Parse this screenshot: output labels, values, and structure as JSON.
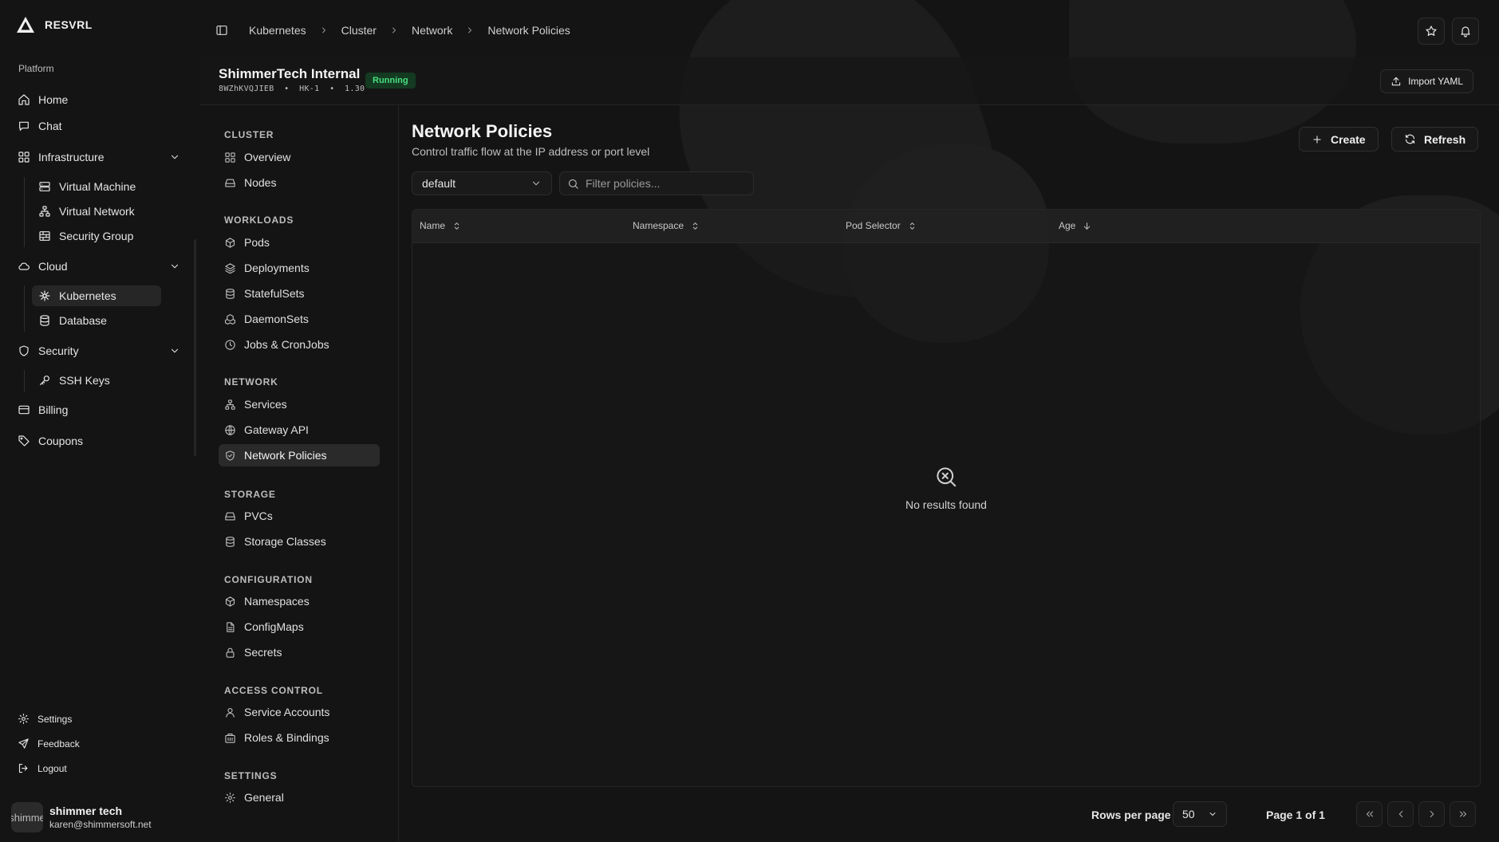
{
  "brand": {
    "name": "RESVRL"
  },
  "sidebar": {
    "section": "Platform",
    "items": [
      {
        "label": "Home",
        "icon": "home-icon"
      },
      {
        "label": "Chat",
        "icon": "chat-icon"
      },
      {
        "label": "Infrastructure",
        "icon": "grid-icon",
        "expanded": true,
        "children": [
          {
            "label": "Virtual Machine",
            "icon": "server-icon"
          },
          {
            "label": "Virtual Network",
            "icon": "network-icon"
          },
          {
            "label": "Security Group",
            "icon": "firewall-icon"
          }
        ]
      },
      {
        "label": "Cloud",
        "icon": "cloud-icon",
        "expanded": true,
        "children": [
          {
            "label": "Kubernetes",
            "icon": "helm-icon",
            "active": true
          },
          {
            "label": "Database",
            "icon": "database-icon"
          }
        ]
      },
      {
        "label": "Security",
        "icon": "shield-icon",
        "expanded": true,
        "children": [
          {
            "label": "SSH Keys",
            "icon": "key-icon"
          }
        ]
      },
      {
        "label": "Billing",
        "icon": "credit-card-icon"
      },
      {
        "label": "Coupons",
        "icon": "tag-icon"
      }
    ],
    "footer": [
      {
        "label": "Settings",
        "icon": "gear-icon"
      },
      {
        "label": "Feedback",
        "icon": "send-icon"
      },
      {
        "label": "Logout",
        "icon": "logout-icon"
      }
    ],
    "user": {
      "avatar_text": "shimme",
      "name": "shimmer tech",
      "email": "karen@shimmersoft.net"
    }
  },
  "breadcrumb": [
    "Kubernetes",
    "Cluster",
    "Network",
    "Network Policies"
  ],
  "cluster": {
    "name": "ShimmerTech Internal",
    "id": "8WZhKVQJIEB",
    "region": "HK-1",
    "version": "1.30",
    "status": "Running",
    "import_label": "Import YAML"
  },
  "subnav": [
    {
      "heading": "CLUSTER",
      "items": [
        {
          "label": "Overview",
          "icon": "grid-icon"
        },
        {
          "label": "Nodes",
          "icon": "hard-drive-icon"
        }
      ]
    },
    {
      "heading": "WORKLOADS",
      "items": [
        {
          "label": "Pods",
          "icon": "box-icon"
        },
        {
          "label": "Deployments",
          "icon": "layers-icon"
        },
        {
          "label": "StatefulSets",
          "icon": "database-icon"
        },
        {
          "label": "DaemonSets",
          "icon": "boxes-icon"
        },
        {
          "label": "Jobs & CronJobs",
          "icon": "clock-icon"
        }
      ]
    },
    {
      "heading": "NETWORK",
      "items": [
        {
          "label": "Services",
          "icon": "network-icon"
        },
        {
          "label": "Gateway API",
          "icon": "globe-icon"
        },
        {
          "label": "Network Policies",
          "icon": "shield-check-icon",
          "active": true
        }
      ]
    },
    {
      "heading": "STORAGE",
      "items": [
        {
          "label": "PVCs",
          "icon": "hard-drive-icon"
        },
        {
          "label": "Storage Classes",
          "icon": "database-icon"
        }
      ]
    },
    {
      "heading": "CONFIGURATION",
      "items": [
        {
          "label": "Namespaces",
          "icon": "box-icon"
        },
        {
          "label": "ConfigMaps",
          "icon": "file-icon"
        },
        {
          "label": "Secrets",
          "icon": "lock-icon"
        }
      ]
    },
    {
      "heading": "ACCESS CONTROL",
      "items": [
        {
          "label": "Service Accounts",
          "icon": "user-icon"
        },
        {
          "label": "Roles & Bindings",
          "icon": "building-icon"
        }
      ]
    },
    {
      "heading": "SETTINGS",
      "items": [
        {
          "label": "General",
          "icon": "gear-icon"
        }
      ]
    }
  ],
  "main": {
    "title": "Network Policies",
    "subtitle": "Control traffic flow at the IP address or port level",
    "create_label": "Create",
    "refresh_label": "Refresh",
    "namespace": "default",
    "search_placeholder": "Filter policies...",
    "columns": [
      "Name",
      "Namespace",
      "Pod Selector",
      "Age"
    ],
    "rows": [],
    "empty_text": "No results found",
    "rows_per_page_label": "Rows per page",
    "rows_per_page": "50",
    "page_info": "Page 1 of 1"
  },
  "colors": {
    "background": "#141414",
    "running_badge": "#4ade80"
  }
}
